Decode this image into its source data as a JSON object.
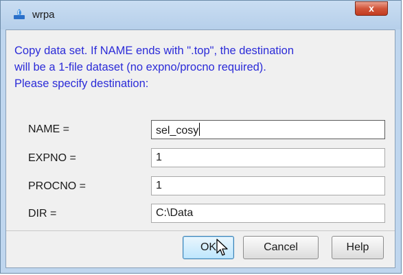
{
  "window": {
    "title": "wrpa",
    "close_glyph": "x",
    "icon": "wrpa-app-icon"
  },
  "message": {
    "line1": "Copy data set. If NAME ends with \".top\", the destination",
    "line2": "will be a 1-file dataset (no expno/procno required).",
    "line3": "Please specify destination:"
  },
  "fields": {
    "name": {
      "label": "NAME =",
      "value": "sel_cosy"
    },
    "expno": {
      "label": "EXPNO =",
      "value": "1"
    },
    "procno": {
      "label": "PROCNO =",
      "value": "1"
    },
    "dir": {
      "label": "DIR =",
      "value": "C:\\Data"
    }
  },
  "buttons": {
    "ok": "OK",
    "cancel": "Cancel",
    "help": "Help"
  },
  "colors": {
    "message_text": "#2b2bd8",
    "titlebar": "#bfd6ee",
    "close_button": "#c84a2e",
    "default_button": "#bee6fd"
  }
}
